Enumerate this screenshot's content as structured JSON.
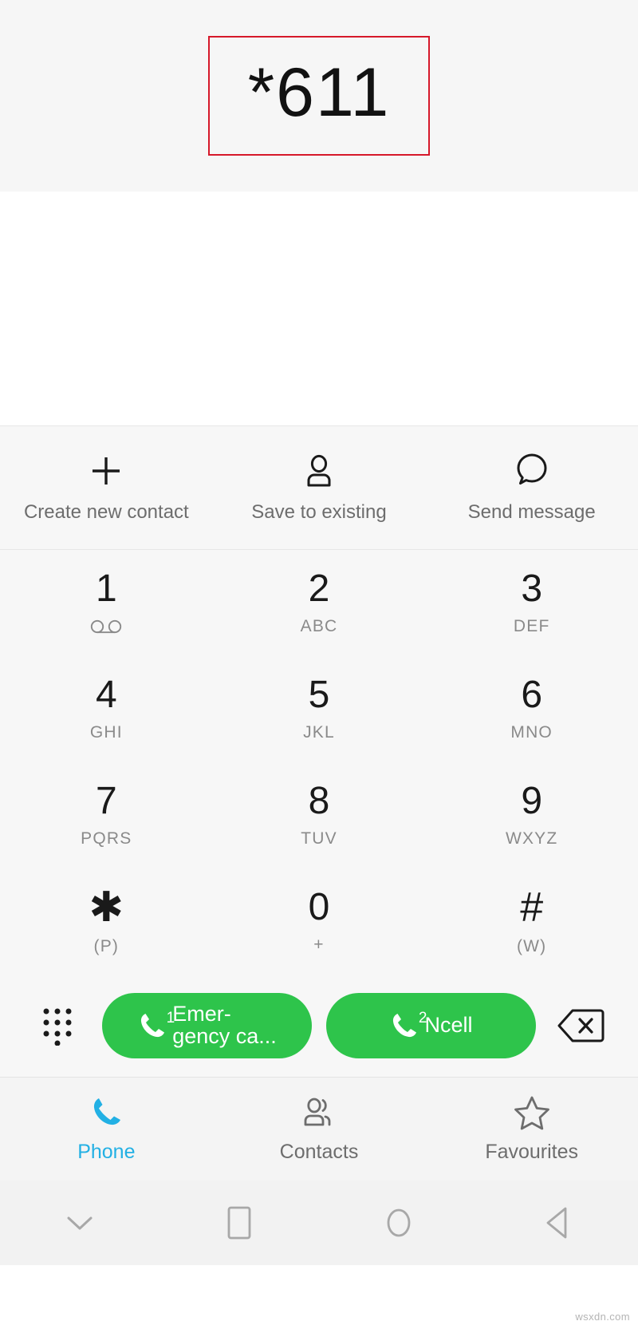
{
  "display": {
    "number": "*611",
    "annotation_box_color": "#d6182a"
  },
  "quick_actions": [
    {
      "label": "Create new contact",
      "icon": "plus-icon"
    },
    {
      "label": "Save to existing",
      "icon": "person-icon"
    },
    {
      "label": "Send message",
      "icon": "speech-bubble-icon"
    }
  ],
  "keypad": {
    "rows": [
      [
        {
          "digit": "1",
          "sub": "",
          "icon": "voicemail-icon"
        },
        {
          "digit": "2",
          "sub": "ABC",
          "icon": ""
        },
        {
          "digit": "3",
          "sub": "DEF",
          "icon": ""
        }
      ],
      [
        {
          "digit": "4",
          "sub": "GHI",
          "icon": ""
        },
        {
          "digit": "5",
          "sub": "JKL",
          "icon": ""
        },
        {
          "digit": "6",
          "sub": "MNO",
          "icon": ""
        }
      ],
      [
        {
          "digit": "7",
          "sub": "PQRS",
          "icon": ""
        },
        {
          "digit": "8",
          "sub": "TUV",
          "icon": ""
        },
        {
          "digit": "9",
          "sub": "WXYZ",
          "icon": ""
        }
      ],
      [
        {
          "digit": "✱",
          "sub": "(P)",
          "icon": ""
        },
        {
          "digit": "0",
          "sub": "+",
          "icon": ""
        },
        {
          "digit": "#",
          "sub": "(W)",
          "icon": ""
        }
      ]
    ]
  },
  "call_bar": {
    "dialpad_toggle_icon": "dialpad-icon",
    "backspace_icon": "backspace-icon",
    "buttons": [
      {
        "sim": "1",
        "label": "Emer-\ngency ca...",
        "color": "#2ec44b"
      },
      {
        "sim": "2",
        "label": "Ncell",
        "color": "#2ec44b"
      }
    ]
  },
  "tabs": [
    {
      "label": "Phone",
      "icon": "phone-icon",
      "active": true,
      "color": "#22b0e4"
    },
    {
      "label": "Contacts",
      "icon": "contacts-icon",
      "active": false,
      "color": "#6d6d6d"
    },
    {
      "label": "Favourites",
      "icon": "star-icon",
      "active": false,
      "color": "#6d6d6d"
    }
  ],
  "navbar": [
    {
      "icon": "chevron-down-icon"
    },
    {
      "icon": "square-recents-icon"
    },
    {
      "icon": "circle-home-icon"
    },
    {
      "icon": "triangle-back-icon"
    }
  ],
  "watermark": "wsxdn.com"
}
